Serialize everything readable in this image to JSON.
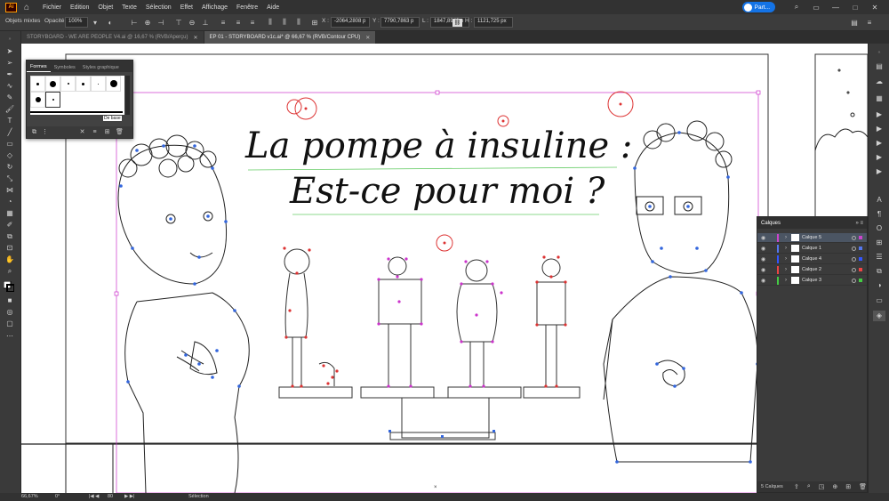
{
  "menubar": {
    "logo": "Ai",
    "items": [
      "Fichier",
      "Edition",
      "Objet",
      "Texte",
      "Sélection",
      "Effet",
      "Affichage",
      "Fenêtre",
      "Aide"
    ],
    "share_label": "Part...",
    "colors": {
      "accent": "#1473e6",
      "logo_border": "#ff9a00"
    }
  },
  "controlbar": {
    "selection_type": "Objets mixtes",
    "opacity_label": "Opacité :",
    "opacity_value": "100%",
    "x_label": "X :",
    "x_value": "-2064,2808 p",
    "y_label": "Y :",
    "y_value": "7790,7863 p",
    "w_label": "L :",
    "w_value": "1847,8942 p",
    "h_label": "H :",
    "h_value": "1121,725 px"
  },
  "tabs": [
    {
      "label": "STORYBOARD - WE ARE PEOPLE V4.ai @ 16,67 % (RVB/Aperçu)",
      "active": false
    },
    {
      "label": "EP 01 - STORYBOARD v1c.ai* @ 66,67 % (RVB/Contour CPU)",
      "active": true
    }
  ],
  "canvas": {
    "title_line1": "La pompe à insuline :",
    "title_line2": "Est-ce pour moi ?"
  },
  "formes_panel": {
    "tabs": [
      "Formes",
      "Symboles",
      "Styles graphique"
    ],
    "base_label": "De base"
  },
  "layers_panel": {
    "title": "Calques",
    "layers": [
      {
        "name": "Calque 5",
        "color": "#cc44cc",
        "selected": true
      },
      {
        "name": "Calque 1",
        "color": "#5577ee",
        "selected": false
      },
      {
        "name": "Calque 4",
        "color": "#3355ff",
        "selected": false
      },
      {
        "name": "Calque 2",
        "color": "#ee4444",
        "selected": false
      },
      {
        "name": "Calque 3",
        "color": "#44cc44",
        "selected": false
      }
    ],
    "count_label": "5 Calques"
  },
  "statusbar": {
    "zoom": "66,67%",
    "rotation": "0°",
    "page": "80",
    "tool": "Sélection"
  }
}
